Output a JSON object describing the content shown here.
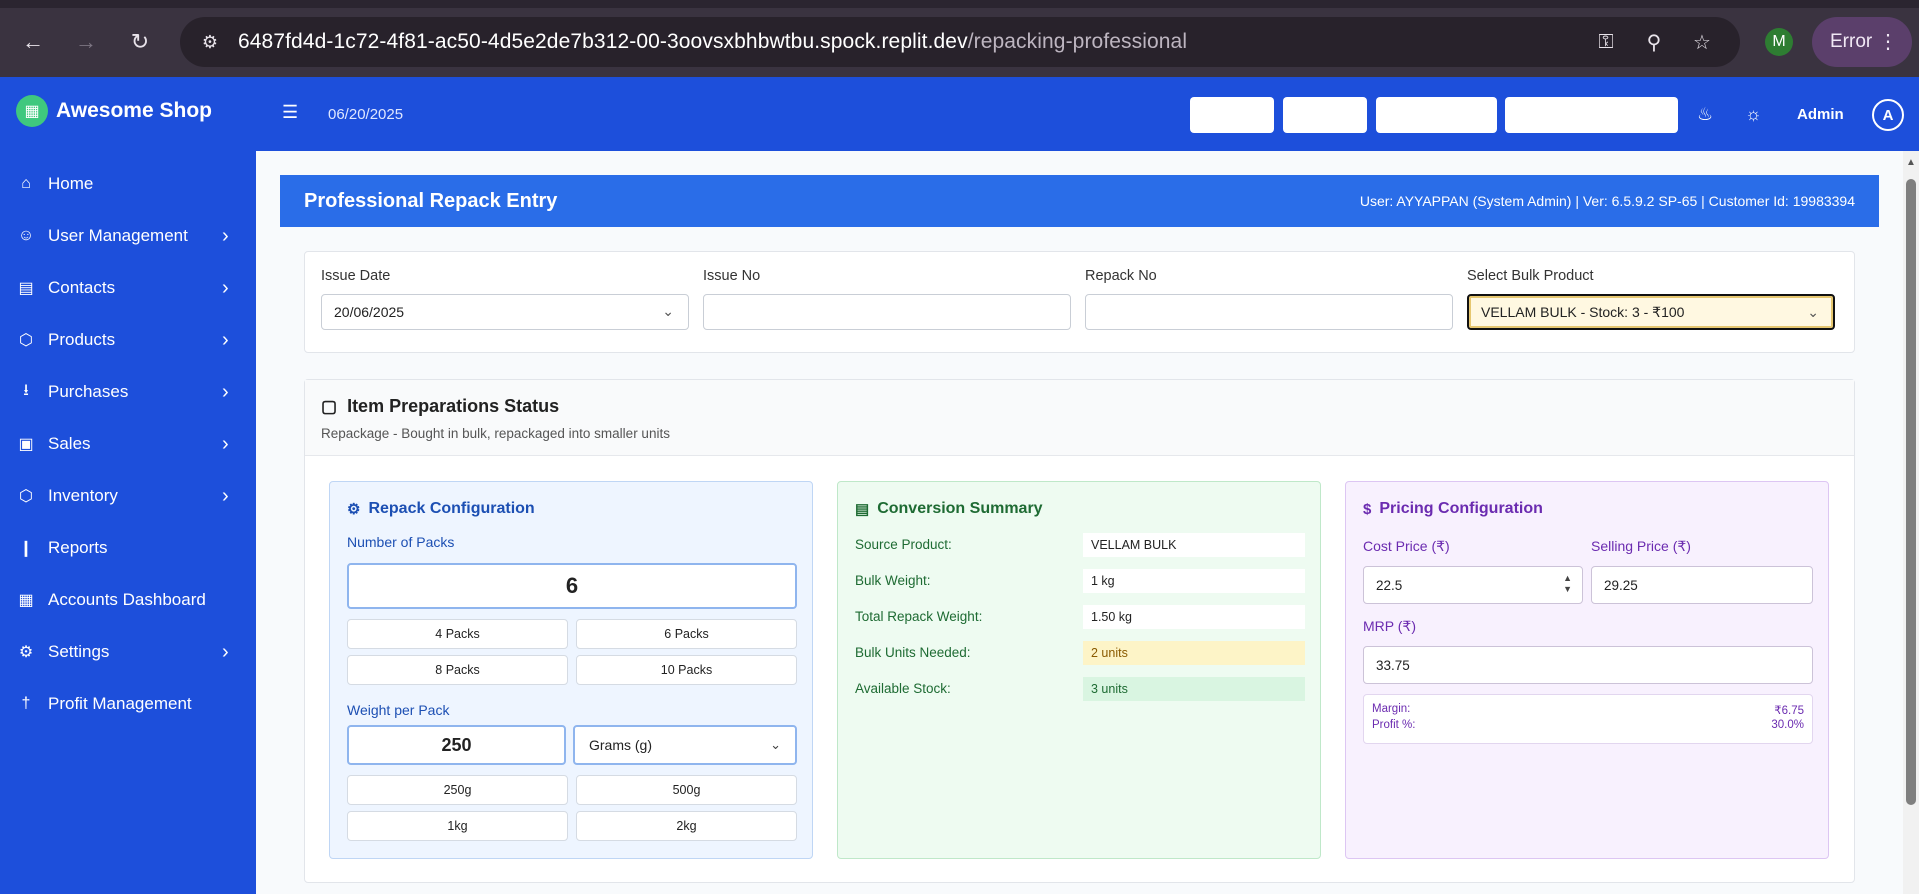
{
  "browser": {
    "url_host": "6487fd4d-1c72-4f81-ac50-4d5e2de7b312-00-3oovsxbhbwtbu.spock.replit.dev",
    "url_path": "/repacking-professional",
    "profile_initial": "M",
    "error_label": "Error"
  },
  "sidebar": {
    "brand": "Awesome Shop",
    "items": [
      {
        "label": "Home",
        "icon": "home-icon",
        "has_children": false
      },
      {
        "label": "User Management",
        "icon": "user-icon",
        "has_children": true
      },
      {
        "label": "Contacts",
        "icon": "contacts-icon",
        "has_children": true
      },
      {
        "label": "Products",
        "icon": "box-icon",
        "has_children": true
      },
      {
        "label": "Purchases",
        "icon": "download-icon",
        "has_children": true
      },
      {
        "label": "Sales",
        "icon": "bag-icon",
        "has_children": true
      },
      {
        "label": "Inventory",
        "icon": "box-icon",
        "has_children": true
      },
      {
        "label": "Reports",
        "icon": "bar-chart-icon",
        "has_children": false
      },
      {
        "label": "Accounts Dashboard",
        "icon": "calculator-icon",
        "has_children": false
      },
      {
        "label": "Settings",
        "icon": "gear-icon",
        "has_children": true
      },
      {
        "label": "Profit Management",
        "icon": "pin-icon",
        "has_children": false
      }
    ]
  },
  "topbar": {
    "date": "06/20/2025",
    "admin": "Admin",
    "avatar_initial": "A"
  },
  "page": {
    "title": "Professional Repack Entry",
    "meta": "User: AYYAPPAN (System Admin) | Ver: 6.5.9.2 SP-65 | Customer Id: 19983394"
  },
  "form": {
    "issue_date_label": "Issue Date",
    "issue_date_value": "20/06/2025",
    "issue_no_label": "Issue No",
    "issue_no_value": "",
    "repack_no_label": "Repack No",
    "repack_no_value": "",
    "bulk_product_label": "Select Bulk Product",
    "bulk_product_value": "VELLAM BULK - Stock: 3 - ₹100"
  },
  "status": {
    "title": "Item Preparations Status",
    "subtitle": "Repackage - Bought in bulk, repackaged into smaller units"
  },
  "repack_config": {
    "title": "Repack Configuration",
    "packs_label": "Number of Packs",
    "packs_value": "6",
    "pack_presets": [
      "4 Packs",
      "6 Packs",
      "8 Packs",
      "10 Packs"
    ],
    "weight_label": "Weight per Pack",
    "weight_value": "250",
    "unit_value": "Grams (g)",
    "weight_presets": [
      "250g",
      "500g",
      "1kg",
      "2kg"
    ]
  },
  "conversion": {
    "title": "Conversion Summary",
    "rows": [
      {
        "label": "Source Product:",
        "value": "VELLAM BULK"
      },
      {
        "label": "Bulk Weight:",
        "value": "1 kg"
      },
      {
        "label": "Total Repack Weight:",
        "value": "1.50 kg"
      },
      {
        "label": "Bulk Units Needed:",
        "value": "2 units"
      },
      {
        "label": "Available Stock:",
        "value": "3 units"
      }
    ]
  },
  "pricing": {
    "title": "Pricing Configuration",
    "cost_label": "Cost Price (₹)",
    "cost_value": "22.5",
    "selling_label": "Selling Price (₹)",
    "selling_value": "29.25",
    "mrp_label": "MRP (₹)",
    "mrp_value": "33.75",
    "margin_label": "Margin:",
    "margin_value": "₹6.75",
    "profit_label": "Profit %:",
    "profit_value": "30.0%"
  },
  "colors": {
    "sidebar_bg": "#1d4fdb",
    "header_bg": "#2a6de8",
    "accent_green": "#3fc87e"
  }
}
